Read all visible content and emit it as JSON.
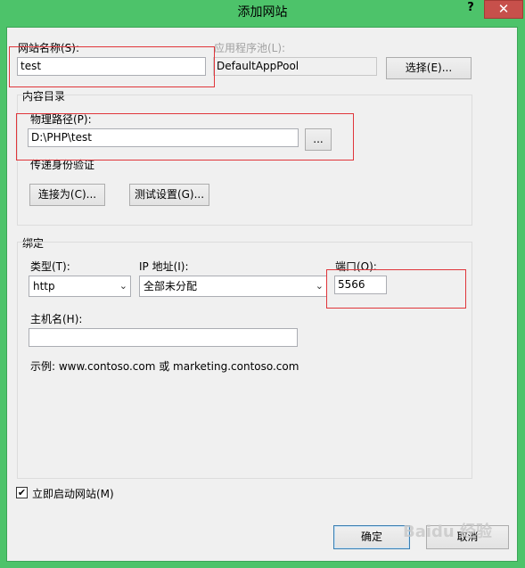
{
  "window": {
    "title": "添加网站",
    "help_glyph": "?",
    "close_glyph": "✕"
  },
  "site": {
    "name_label": "网站名称(S):",
    "name_value": "test",
    "pool_label": "应用程序池(L):",
    "pool_value": "DefaultAppPool",
    "select_button": "选择(E)..."
  },
  "content": {
    "group_label": "内容目录",
    "path_label": "物理路径(P):",
    "path_value": "D:\\PHP\\test",
    "browse_button": "...",
    "auth_label": "传递身份验证",
    "connect_as_button": "连接为(C)...",
    "test_settings_button": "测试设置(G)..."
  },
  "binding": {
    "group_label": "绑定",
    "type_label": "类型(T):",
    "type_value": "http",
    "ip_label": "IP 地址(I):",
    "ip_value": "全部未分配",
    "port_label": "端口(O):",
    "port_value": "5566",
    "host_label": "主机名(H):",
    "host_value": "",
    "example_text": "示例: www.contoso.com 或 marketing.contoso.com"
  },
  "start": {
    "label": "立即启动网站(M)",
    "checked": true,
    "check_glyph": "✔"
  },
  "footer": {
    "ok_button": "确定",
    "cancel_button": "取消"
  },
  "watermark": "Baidu 经验"
}
